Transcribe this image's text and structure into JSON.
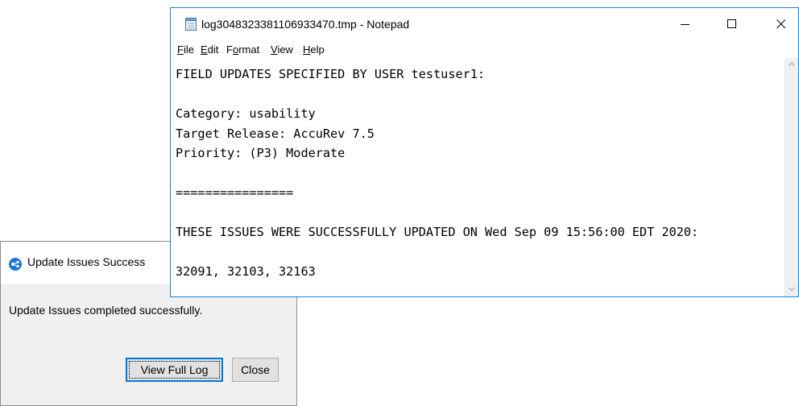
{
  "dialog": {
    "title": "Update Issues Success",
    "message": "Update Issues completed successfully.",
    "buttons": {
      "view_full_log": "View Full Log",
      "close": "Close"
    },
    "icon": "accurev-app-icon"
  },
  "notepad": {
    "title": "log3048323381106933470.tmp - Notepad",
    "icon": "notepad-icon",
    "window_controls": [
      "minimize-icon",
      "maximize-icon",
      "close-icon"
    ],
    "menu": [
      "File",
      "Edit",
      "Format",
      "View",
      "Help"
    ],
    "lines": [
      "FIELD UPDATES SPECIFIED BY USER testuser1:",
      "",
      "Category: usability",
      "Target Release: AccuRev 7.5",
      "Priority: (P3) Moderate",
      "",
      "================",
      "",
      "THESE ISSUES WERE SUCCESSFULLY UPDATED ON Wed Sep 09 15:56:00 EDT 2020:",
      "",
      "32091, 32103, 32163"
    ]
  },
  "colors": {
    "notepad_border": "#1883d7",
    "dialog_bg": "#f0f0f0",
    "primary_button_border": "#0078d7",
    "app_icon": "#1e77d3"
  }
}
